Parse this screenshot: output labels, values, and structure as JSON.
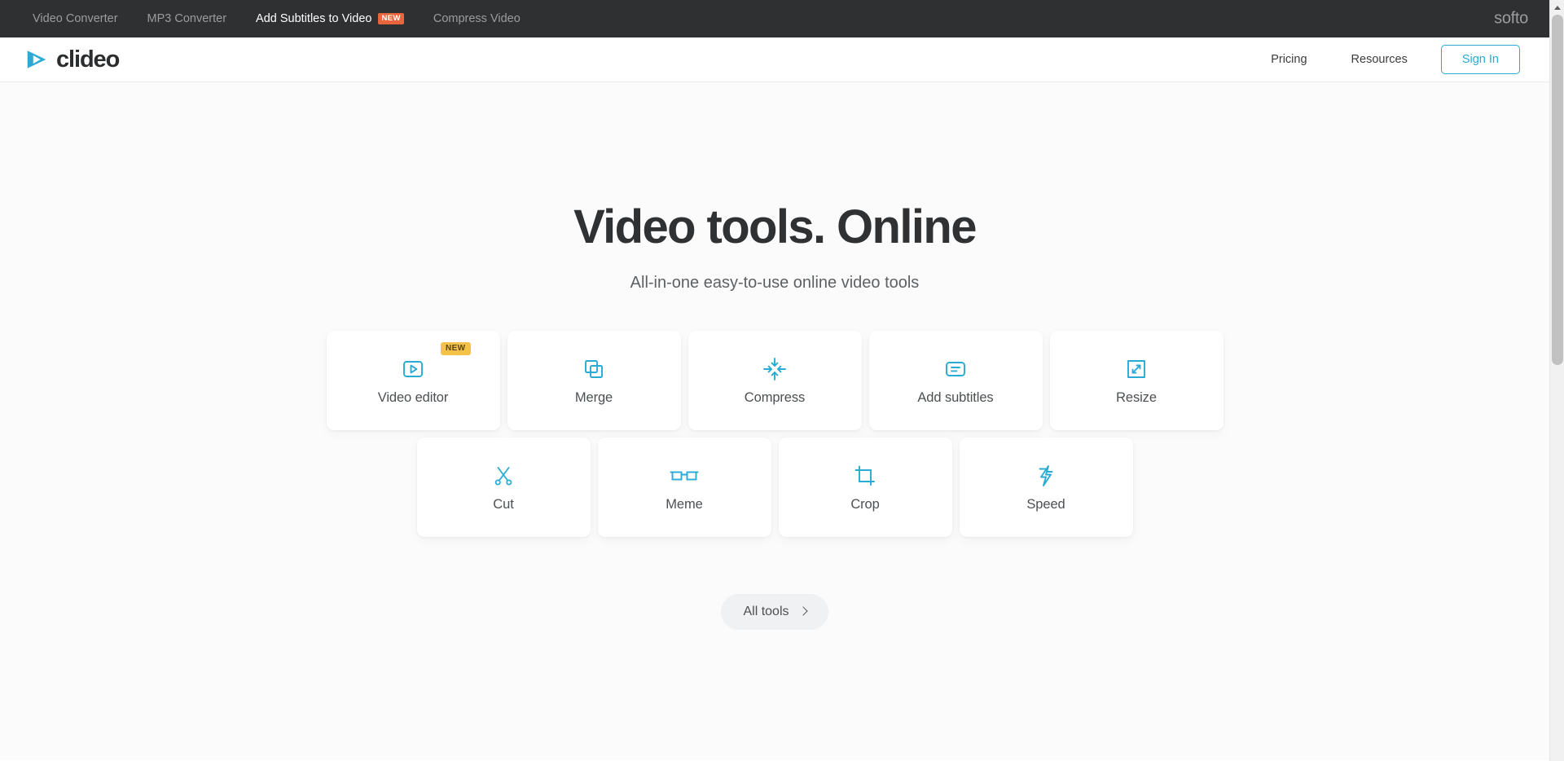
{
  "topbar": {
    "links": [
      {
        "label": "Video Converter",
        "active": false,
        "badge": null
      },
      {
        "label": "MP3 Converter",
        "active": false,
        "badge": null
      },
      {
        "label": "Add Subtitles to Video",
        "active": true,
        "badge": "NEW"
      },
      {
        "label": "Compress Video",
        "active": false,
        "badge": null
      }
    ],
    "network_logo": "softo",
    "background_color": "#2e3032",
    "badge_color": "#e8643c"
  },
  "header": {
    "brand": "clideo",
    "brand_icon": "play-logo-icon",
    "brand_color": "#29abd4",
    "nav": [
      {
        "label": "Pricing"
      },
      {
        "label": "Resources"
      }
    ],
    "signin_label": "Sign In",
    "signin_color": "#29abd4"
  },
  "hero": {
    "title": "Video tools. Online",
    "subtitle": "All-in-one easy-to-use online video tools"
  },
  "tools": {
    "accent_color": "#29abd4",
    "row1": [
      {
        "label": "Video editor",
        "icon": "video-editor-icon",
        "badge": "NEW"
      },
      {
        "label": "Merge",
        "icon": "merge-icon",
        "badge": null
      },
      {
        "label": "Compress",
        "icon": "compress-icon",
        "badge": null
      },
      {
        "label": "Add subtitles",
        "icon": "subtitles-icon",
        "badge": null
      },
      {
        "label": "Resize",
        "icon": "resize-icon",
        "badge": null
      }
    ],
    "row2": [
      {
        "label": "Cut",
        "icon": "scissors-icon",
        "badge": null
      },
      {
        "label": "Meme",
        "icon": "glasses-icon",
        "badge": null
      },
      {
        "label": "Crop",
        "icon": "crop-icon",
        "badge": null
      },
      {
        "label": "Speed",
        "icon": "lightning-icon",
        "badge": null
      }
    ]
  },
  "all_tools": {
    "label": "All tools",
    "icon": "chevron-right-icon"
  }
}
